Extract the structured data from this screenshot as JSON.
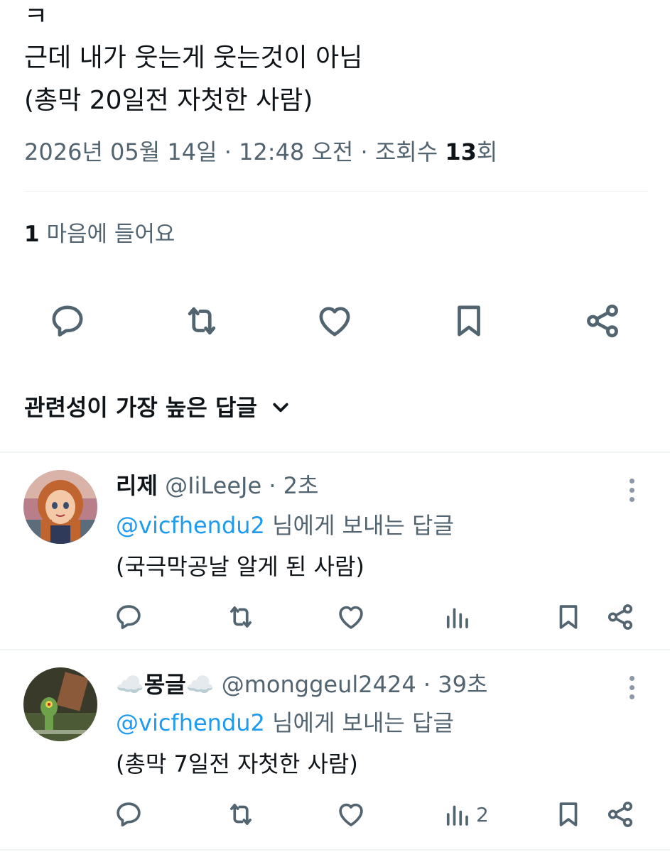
{
  "tweet": {
    "lines": [
      "ㅋ",
      "근데 내가 웃는게 웃는것이 아님",
      "(총막 20일전 자첫한 사람)"
    ],
    "meta": {
      "date": "2026년 05월 14일",
      "sep1": "·",
      "time": "12:48 오전",
      "sep2": "·",
      "views_label": "조회수",
      "views_count": "13",
      "views_suffix": "회"
    },
    "likes": {
      "count": "1",
      "label": "마음에 들어요"
    },
    "actions": [
      "reply-icon",
      "retweet-icon",
      "heart-icon",
      "bookmark-icon",
      "share-icon"
    ]
  },
  "sort": {
    "label": "관련성이 가장 높은 답글",
    "icon": "chevron-down-icon"
  },
  "replies": [
    {
      "name": "리제",
      "handle": "@IiLeeJe",
      "sep": "·",
      "time": "2초",
      "mention": "@vicfhendu2",
      "reply_suffix": "님에게 보내는 답글",
      "text": "(국극막공날 알게 된 사람)",
      "views": ""
    },
    {
      "name": "몽글",
      "handle": "@monggeul2424",
      "sep": "·",
      "time": "39초",
      "mention": "@vicfhendu2",
      "reply_suffix": "님에게 보내는 답글",
      "text": "(총막 7일전 자첫한 사람)",
      "views": "2"
    }
  ],
  "colors": {
    "text": "#0f1419",
    "muted": "#536471",
    "accent": "#1d9bf0",
    "divider": "#eff3f4"
  }
}
